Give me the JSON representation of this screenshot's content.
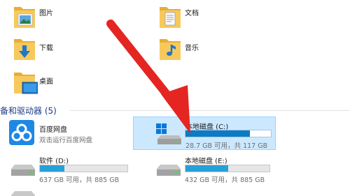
{
  "folders": [
    {
      "label": "图片",
      "icon": "pictures-folder-icon"
    },
    {
      "label": "文档",
      "icon": "documents-folder-icon"
    },
    {
      "label": "下载",
      "icon": "downloads-folder-icon"
    },
    {
      "label": "音乐",
      "icon": "music-folder-icon"
    },
    {
      "label": "桌面",
      "icon": "desktop-folder-icon"
    }
  ],
  "devices_section": {
    "title": "备和驱动器 (5)"
  },
  "devices": [
    {
      "name": "百度网盘",
      "sub": "双击运行百度网盘",
      "icon": "baidu-netdisk-icon"
    },
    {
      "name": "本地磁盘 (C:)",
      "sub": "28.7 GB 可用，共 117 GB",
      "used_fraction": 0.755,
      "selected": true,
      "icon": "windows-system-drive-icon"
    },
    {
      "name": "软件 (D:)",
      "sub": "637 GB 可用，共 885 GB",
      "used_fraction": 0.28,
      "icon": "hard-drive-icon"
    },
    {
      "name": "本地磁盘 (E:)",
      "sub": "432 GB 可用，共 885 GB",
      "used_fraction": 0.51,
      "icon": "hard-drive-icon"
    },
    {
      "name": "",
      "icon": "hard-drive-icon"
    }
  ],
  "colors": {
    "accent": "#26a0da",
    "selection_bg": "#cce8ff",
    "arrow": "#e52521",
    "folder": "#f5c24c"
  }
}
